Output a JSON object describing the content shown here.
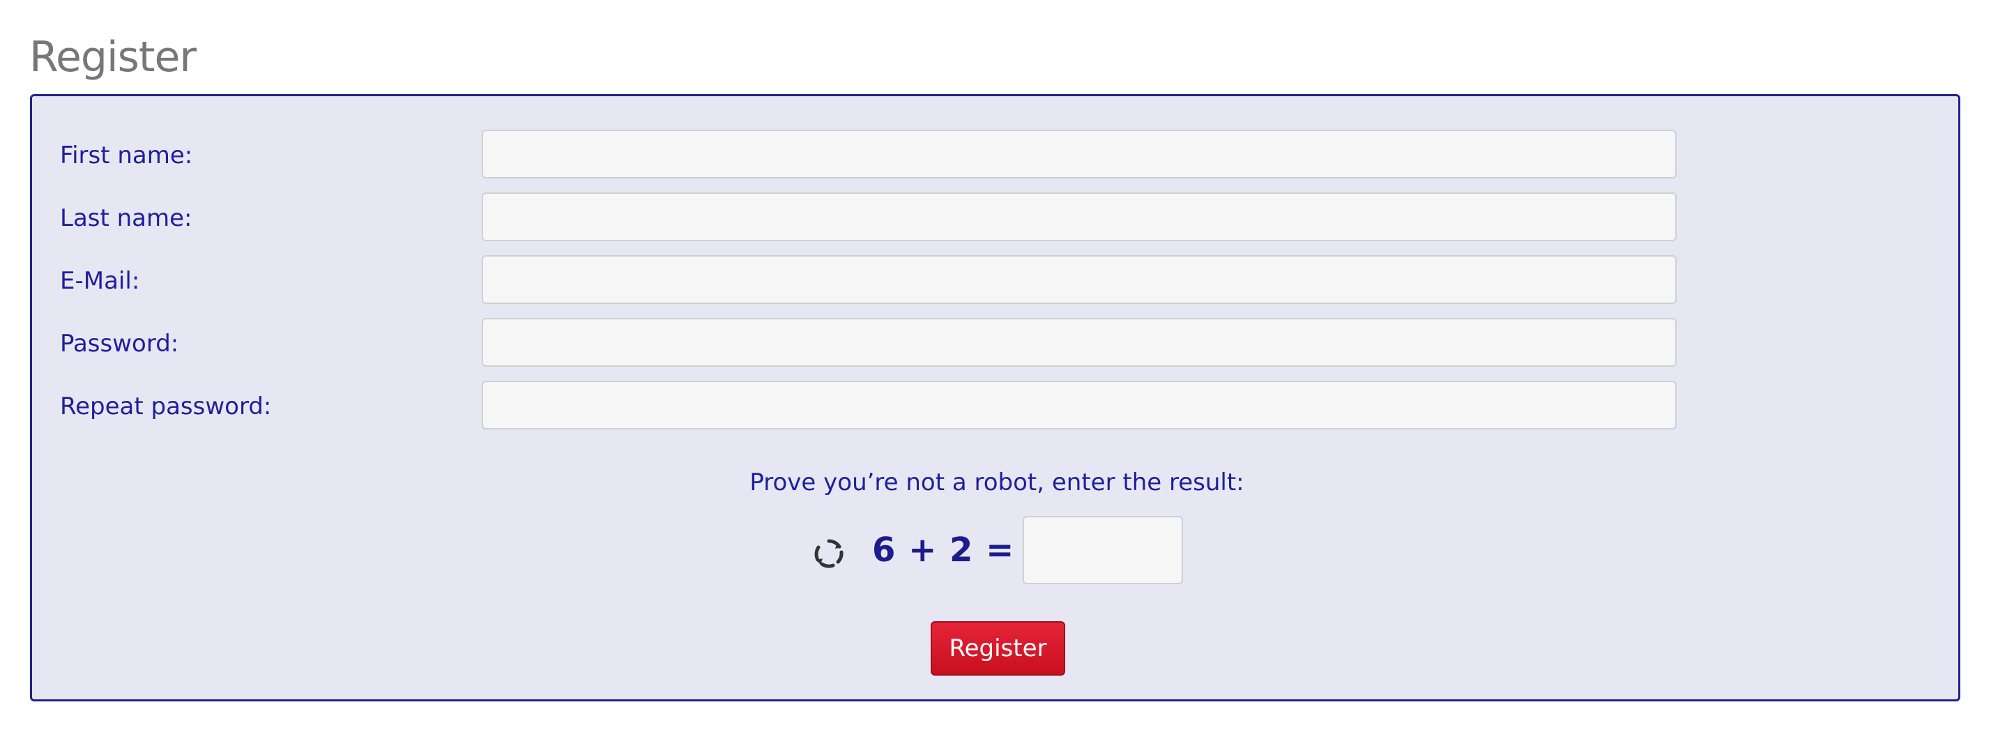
{
  "page": {
    "title": "Register"
  },
  "form": {
    "fields": [
      {
        "label": "First name:",
        "value": ""
      },
      {
        "label": "Last name:",
        "value": ""
      },
      {
        "label": "E-Mail:",
        "value": ""
      },
      {
        "label": "Password:",
        "value": ""
      },
      {
        "label": "Repeat password:",
        "value": ""
      }
    ],
    "captcha": {
      "prompt": "Prove you’re not a robot, enter the result:",
      "equation": "6 + 2 =",
      "value": "",
      "refresh_icon": "refresh-icon"
    },
    "submit_label": "Register"
  },
  "colors": {
    "panel_background": "#e7e7f3",
    "panel_border": "#22228a",
    "label_text": "#1f1f99",
    "title_text": "#777777",
    "button_background": "#d5192b",
    "button_text": "#ffffff"
  }
}
